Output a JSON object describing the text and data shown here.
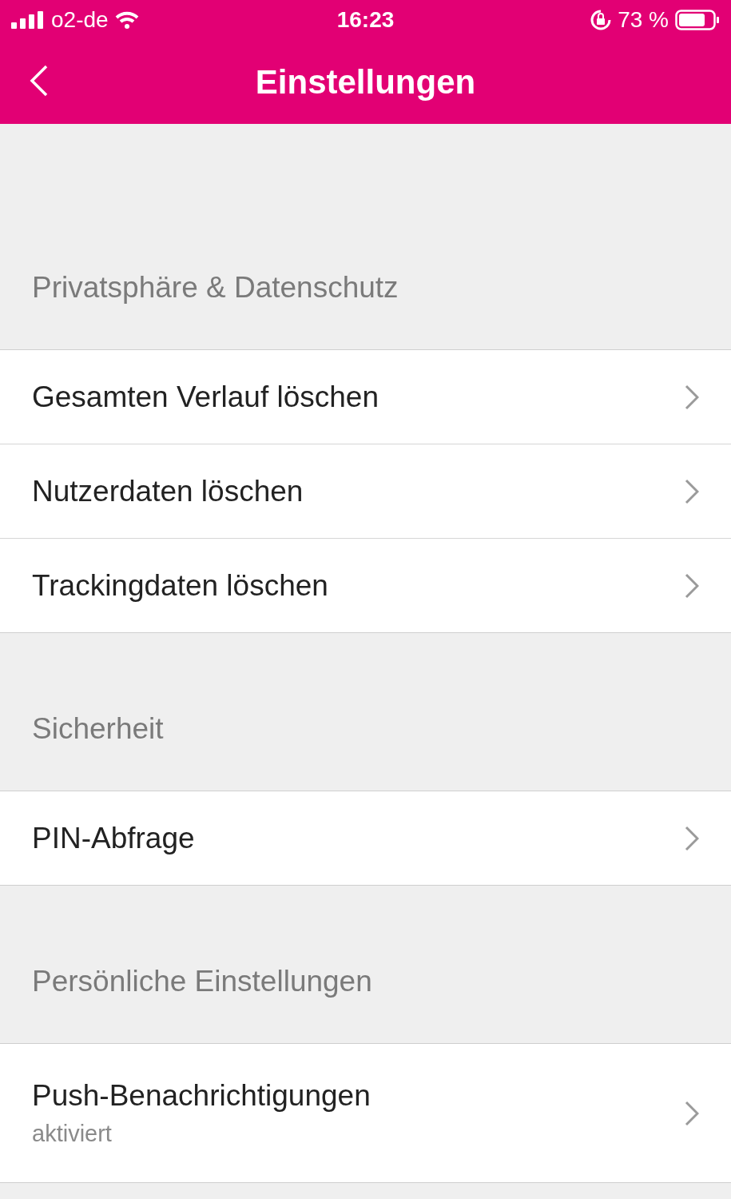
{
  "status_bar": {
    "carrier": "o2-de",
    "time": "16:23",
    "battery": "73 %"
  },
  "nav": {
    "title": "Einstellungen"
  },
  "sections": [
    {
      "header": "Privatsphäre & Datenschutz",
      "items": [
        {
          "label": "Gesamten Verlauf löschen"
        },
        {
          "label": "Nutzerdaten löschen"
        },
        {
          "label": "Trackingdaten löschen"
        }
      ]
    },
    {
      "header": "Sicherheit",
      "items": [
        {
          "label": "PIN-Abfrage"
        }
      ]
    },
    {
      "header": "Persönliche Einstellungen",
      "items": [
        {
          "label": "Push-Benachrichtigungen",
          "subtitle": "aktiviert"
        }
      ]
    }
  ]
}
